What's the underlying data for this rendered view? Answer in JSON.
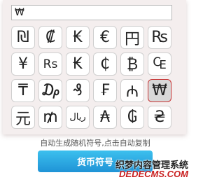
{
  "input": {
    "value": "₩"
  },
  "symbols": [
    [
      "₪",
      "₡",
      "₭",
      "€",
      "円",
      "₨"
    ],
    [
      "¥",
      "Rs",
      "₭",
      "₵",
      "₿",
      "₠"
    ],
    [
      "₸",
      "₯",
      "₰",
      "₣",
      "₼",
      "₩"
    ],
    [
      "元",
      "₥",
      "ريال",
      "₳",
      "₲",
      "₴"
    ]
  ],
  "selected_symbol": "₩",
  "hint": "自动生成随机符号,点击自动复制",
  "button": {
    "label": "货币符号"
  },
  "watermark": {
    "line1": "织梦内容管理系统",
    "line2": "DEDECMS.COM"
  }
}
